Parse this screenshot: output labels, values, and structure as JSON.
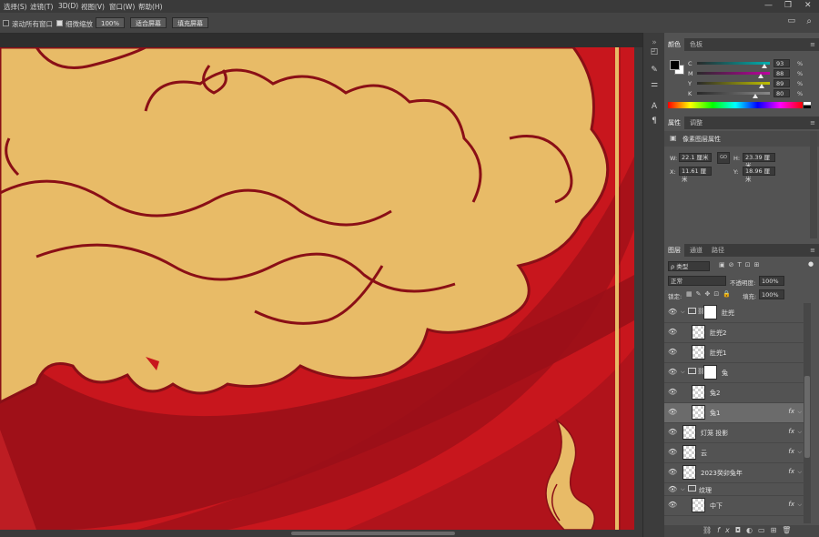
{
  "menubar": {
    "items": [
      "选择(S)",
      "滤镜(T)",
      "3D(D)",
      "视图(V)",
      "窗口(W)",
      "帮助(H)"
    ],
    "controls": {
      "minimize": "—",
      "restore": "❐",
      "close": "✕"
    }
  },
  "options": {
    "scroll_all_label": "滚动所有窗口",
    "scroll_all_checked": false,
    "fine_zoom_label": "细微缩放",
    "fine_zoom_checked": true,
    "zoom_value": "100%",
    "fit_screen_label": "适合屏幕",
    "fill_screen_label": "填充屏幕"
  },
  "color_panel": {
    "tabs": [
      "颜色",
      "色板"
    ],
    "channels": [
      {
        "label": "C",
        "value": "93",
        "unit": "%",
        "fraction": 0.93,
        "color": "#00b0b0"
      },
      {
        "label": "M",
        "value": "88",
        "unit": "%",
        "fraction": 0.88,
        "color": "#c000a0"
      },
      {
        "label": "Y",
        "value": "89",
        "unit": "%",
        "fraction": 0.89,
        "color": "#c0c000"
      },
      {
        "label": "K",
        "value": "80",
        "unit": "%",
        "fraction": 0.8,
        "color": "#888888"
      }
    ],
    "foreground": "#000000",
    "background": "#ffffff"
  },
  "properties_panel": {
    "tabs": [
      "属性",
      "调整"
    ],
    "title": "像素图层属性",
    "w_label": "W:",
    "w_value": "22.1 厘米",
    "h_label": "H:",
    "h_value": "23.39 厘米",
    "x_label": "X:",
    "x_value": "11.61 厘米",
    "y_label": "Y:",
    "y_value": "18.96 厘米",
    "link_icon": "GO"
  },
  "layers_panel": {
    "tabs": [
      "图层",
      "通道",
      "路径"
    ],
    "filter_label": "ρ 类型",
    "blend_mode": "正常",
    "opacity_label": "不透明度:",
    "opacity_value": "100%",
    "lock_label": "锁定:",
    "fill_label": "填充:",
    "fill_value": "100%",
    "layers": [
      {
        "name": "肚兜",
        "group": true,
        "expanded": true,
        "mask": true,
        "fx": false,
        "selected": false,
        "indent": 0
      },
      {
        "name": "肚兜2",
        "group": false,
        "fx": false,
        "selected": false,
        "indent": 1
      },
      {
        "name": "肚兜1",
        "group": false,
        "fx": false,
        "selected": false,
        "indent": 1
      },
      {
        "name": "兔",
        "group": true,
        "expanded": true,
        "mask": true,
        "fx": false,
        "selected": false,
        "indent": 0
      },
      {
        "name": "兔2",
        "group": false,
        "fx": false,
        "selected": false,
        "indent": 1
      },
      {
        "name": "兔1",
        "group": false,
        "fx": true,
        "selected": true,
        "indent": 1
      },
      {
        "name": "灯笼 投影",
        "group": false,
        "fx": true,
        "selected": false,
        "indent": 0
      },
      {
        "name": "云",
        "group": false,
        "fx": true,
        "selected": false,
        "indent": 0
      },
      {
        "name": "2023癸卯兔年",
        "group": false,
        "fx": true,
        "selected": false,
        "indent": 0
      },
      {
        "name": "纹理",
        "group": true,
        "expanded": true,
        "mask": false,
        "fx": false,
        "selected": false,
        "indent": 0,
        "short": true
      },
      {
        "name": "中下",
        "group": false,
        "fx": true,
        "selected": false,
        "indent": 1
      }
    ],
    "fx_label": "fx"
  },
  "artwork": {
    "bg_red": "#c8161d",
    "dark_red": "#9a1018",
    "gold": "#e8bb67",
    "outline": "#8a0f16"
  }
}
